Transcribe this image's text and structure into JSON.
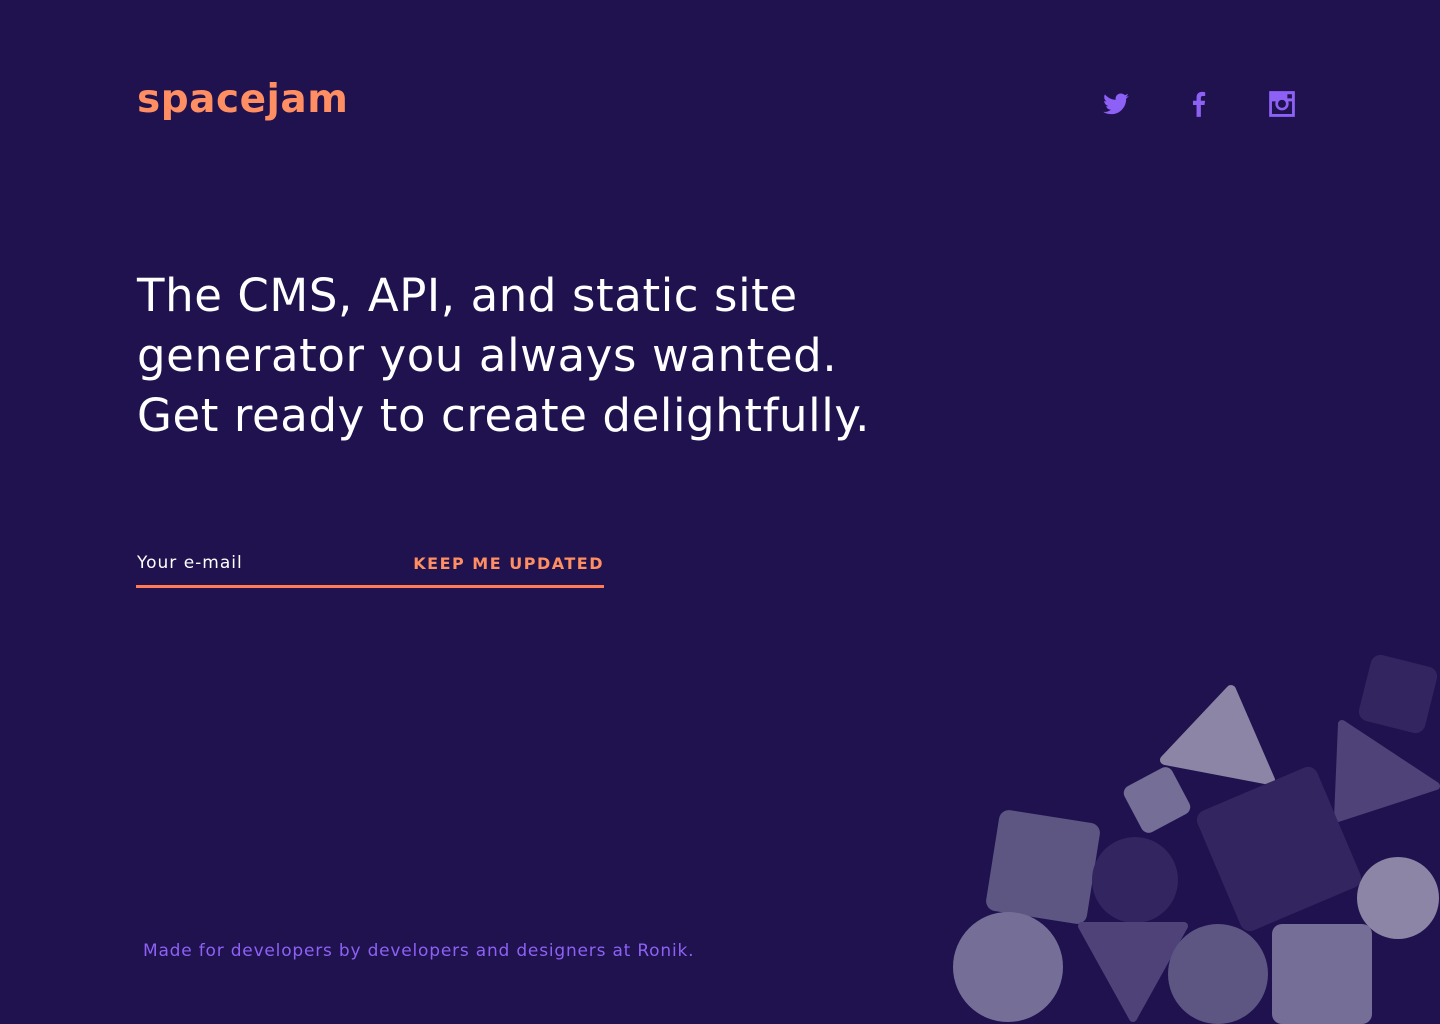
{
  "brand": {
    "name": "spacejam",
    "color": "#ff8f62"
  },
  "social": [
    {
      "name": "Twitter",
      "icon": "twitter-icon"
    },
    {
      "name": "Facebook",
      "icon": "facebook-icon"
    },
    {
      "name": "Instagram",
      "icon": "instagram-icon"
    }
  ],
  "hero": {
    "lines": [
      "The CMS, API, and static site",
      "generator you always wanted.",
      "Get ready to create delightfully."
    ]
  },
  "signup": {
    "email_placeholder": "Your e-mail",
    "email_value": "",
    "button_label": "KEEP ME UPDATED"
  },
  "footer": {
    "text": "Made for developers by developers and designers at Ronik."
  },
  "colors": {
    "background": "#1f124e",
    "accent": "#ff8f62",
    "social_icon": "#8d61f5",
    "footer_text": "#8d61f5"
  }
}
